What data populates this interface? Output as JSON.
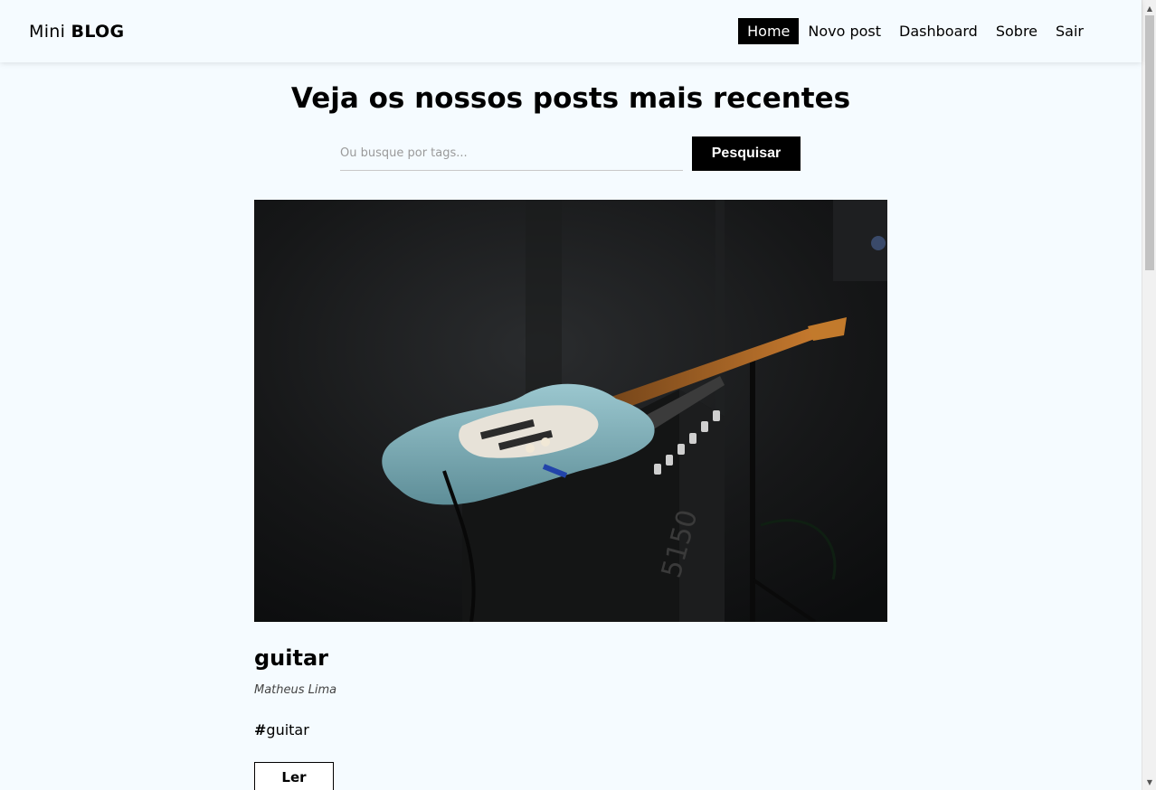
{
  "navbar": {
    "brand_light": "Mini",
    "brand_bold": "BLOG",
    "links": [
      {
        "label": "Home",
        "active": true
      },
      {
        "label": "Novo post"
      },
      {
        "label": "Dashboard"
      },
      {
        "label": "Sobre"
      },
      {
        "label": "Sair"
      }
    ]
  },
  "hero": {
    "title": "Veja os nossos posts mais recentes",
    "search_placeholder": "Ou busque por tags...",
    "search_button": "Pesquisar"
  },
  "posts": [
    {
      "title": "guitar",
      "author": "Matheus Lima",
      "tag_hash": "#",
      "tag": "guitar",
      "read_button": "Ler",
      "image": "guitar-on-amplifier-photo"
    }
  ],
  "colors": {
    "background": "#f5fbff",
    "accent": "#000000",
    "accent_text": "#ffffff"
  }
}
